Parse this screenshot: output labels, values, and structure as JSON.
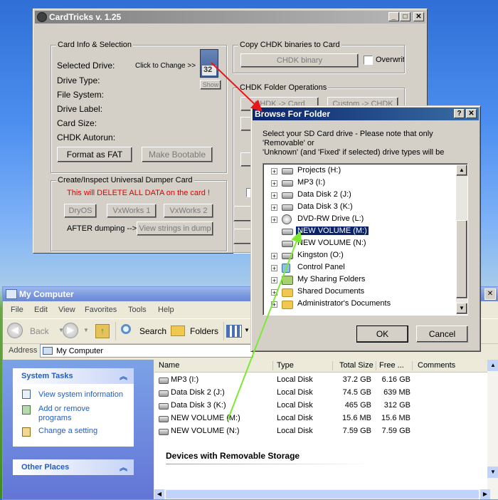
{
  "cardtricks": {
    "title": "CardTricks v. 1.25",
    "card_info": {
      "group_title": "Card Info & Selection",
      "selected_drive_label": "Selected Drive:",
      "click_to_change": "Click to Change >>",
      "sd_number": "32",
      "show_button": "Show",
      "drive_type_label": "Drive Type:",
      "file_system_label": "File System:",
      "drive_label_label": "Drive Label:",
      "card_size_label": "Card Size:",
      "chdk_autorun_label": "CHDK Autorun:",
      "format_button": "Format as FAT",
      "make_bootable_button": "Make Bootable"
    },
    "dumper": {
      "group_title": "Create/Inspect Universal Dumper Card",
      "warning": "This will DELETE ALL DATA on the card !",
      "dryos_button": "DryOS",
      "vxworks1_button": "VxWorks 1",
      "vxworks2_button": "VxWorks 2",
      "after_label": "AFTER dumping -->",
      "view_strings_button": "View strings in dump"
    },
    "copy_chdk": {
      "group_title": "Copy CHDK binaries to Card",
      "binary_button": "CHDK binary",
      "overwrite_label": "Overwrite"
    },
    "folder_ops": {
      "group_title": "CHDK Folder Operations",
      "to_card_button": "CHDK -> Card",
      "custom_button": "Custom -> CHDK"
    }
  },
  "browse": {
    "title": "Browse For Folder",
    "description": "Select your SD Card drive - Please note that only 'Removable' or 'Unknown' and 'Fixed' if selected) drive types will be",
    "description_line1": "Select your SD Card drive - Please note that only",
    "description_line2": "'Removable' or",
    "description_line3": "'Unknown' (and 'Fixed' if selected) drive types will be",
    "tree": [
      {
        "label": "Projects (H:)",
        "expand": true,
        "icon": "drive-icon",
        "selected": false
      },
      {
        "label": "MP3 (I:)",
        "expand": true,
        "icon": "drive-icon",
        "selected": false
      },
      {
        "label": "Data Disk 2 (J:)",
        "expand": true,
        "icon": "drive-icon",
        "selected": false
      },
      {
        "label": "Data Disk 3 (K:)",
        "expand": true,
        "icon": "drive-icon",
        "selected": false
      },
      {
        "label": "DVD-RW Drive (L:)",
        "expand": true,
        "icon": "dvd-icon",
        "selected": false
      },
      {
        "label": "NEW VOLUME (M:)",
        "expand": false,
        "icon": "drive-icon",
        "selected": true
      },
      {
        "label": "NEW VOLUME (N:)",
        "expand": false,
        "icon": "drive-icon",
        "selected": false
      },
      {
        "label": "Kingston (O:)",
        "expand": true,
        "icon": "drive-icon",
        "selected": false
      },
      {
        "label": "Control Panel",
        "expand": true,
        "icon": "control-panel-icon",
        "selected": false
      },
      {
        "label": "My Sharing Folders",
        "expand": true,
        "icon": "sharing-icon",
        "selected": false
      },
      {
        "label": "Shared Documents",
        "expand": true,
        "icon": "folder-icon",
        "selected": false
      },
      {
        "label": "Administrator's Documents",
        "expand": true,
        "icon": "folder-icon",
        "selected": false
      }
    ],
    "ok_button": "OK",
    "cancel_button": "Cancel"
  },
  "mycomputer": {
    "title": "My Computer",
    "menu": [
      "File",
      "Edit",
      "View",
      "Favorites",
      "Tools",
      "Help"
    ],
    "toolbar": {
      "back": "Back",
      "search": "Search",
      "folders": "Folders"
    },
    "address_label": "Address",
    "address_value": "My Computer",
    "system_tasks": {
      "title": "System Tasks",
      "items": [
        "View system information",
        "Add or remove",
        "programs",
        "Change a setting"
      ]
    },
    "other_places_title": "Other Places",
    "columns": [
      "Name",
      "Type",
      "Total Size",
      "Free ...",
      "Comments"
    ],
    "rows": [
      {
        "name": "MP3 (I:)",
        "type": "Local Disk",
        "total": "37.2 GB",
        "free": "6.16 GB"
      },
      {
        "name": "Data Disk 2 (J:)",
        "type": "Local Disk",
        "total": "74.5 GB",
        "free": "639 MB"
      },
      {
        "name": "Data Disk 3 (K:)",
        "type": "Local Disk",
        "total": "465 GB",
        "free": "312 GB"
      },
      {
        "name": "NEW VOLUME (M:)",
        "type": "Local Disk",
        "total": "15.6 MB",
        "free": "15.6 MB"
      },
      {
        "name": "NEW VOLUME (N:)",
        "type": "Local Disk",
        "total": "7.59 GB",
        "free": "7.59 GB"
      }
    ],
    "removable_heading": "Devices with Removable Storage"
  },
  "colors": {
    "xp_title_active": "#0a246a",
    "xp_title_inactive": "#7a96df",
    "selection": "#0a246a",
    "arrow_red": "#e8161a",
    "arrow_green": "#7ee832",
    "warning_red": "#e00000"
  }
}
